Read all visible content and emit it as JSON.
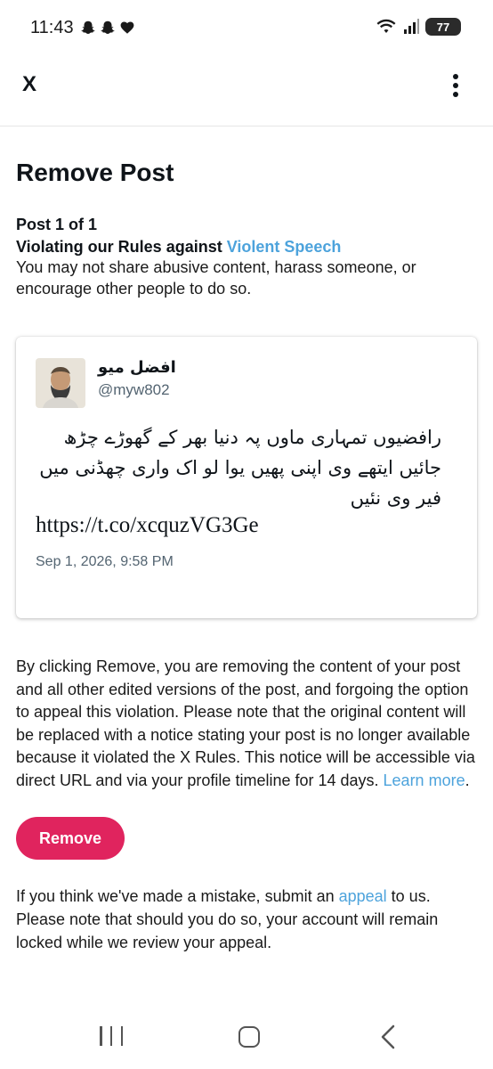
{
  "status_bar": {
    "time": "11:43",
    "left_icons": [
      "snapchat-icon",
      "snapchat-icon",
      "heart-icon"
    ],
    "right_icons": [
      "wifi-icon",
      "signal-icon"
    ],
    "battery": "77"
  },
  "app_bar": {
    "close_label": "X",
    "more_icon": "more-vertical-icon"
  },
  "page": {
    "title": "Remove Post",
    "post_count": "Post 1 of 1",
    "violation_prefix": "Violating our Rules against ",
    "violation_rule": "Violent Speech",
    "violation_description": "You may not share abusive content, harass someone, or encourage other people to do so."
  },
  "post": {
    "author_name": "افضل میو",
    "author_handle": "@myw802",
    "text": "رافضیوں تمہاری ماوں پہ دنیا بھر کے گھوڑے چڑھ جائیں ایتھے وی اپنی پھیں یوا لو اک واری چھڈنی میں فیر وی نئیں",
    "url": "https://t.co/xcquzVG3Ge",
    "date": "Sep 1, 2026, 9:58 PM"
  },
  "notice": {
    "text": "By clicking Remove, you are removing the content of your post and all other edited versions of the post, and forgoing the option to appeal this violation. Please note that the original content will be replaced with a notice stating your post is no longer available because it violated the X Rules. This notice will be accessible via direct URL and via your profile timeline for 14 days. ",
    "learn_more": "Learn more",
    "end": "."
  },
  "remove_button": "Remove",
  "appeal": {
    "prefix": "If you think we've made a mistake, submit an ",
    "link": "appeal",
    "suffix": " to us. Please note that should you do so, your account will remain locked while we review your appeal."
  },
  "colors": {
    "accent_link": "#4da3dc",
    "remove_button": "#e0245e",
    "secondary_text": "#536471"
  }
}
